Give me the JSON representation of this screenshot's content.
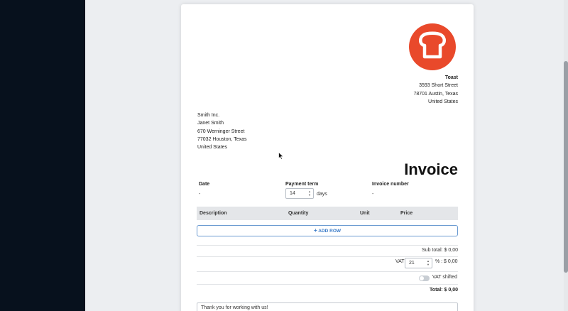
{
  "seller": {
    "name": "Toast",
    "street": "3593 Short Street",
    "city": "78701 Austin, Texas",
    "country": "United States"
  },
  "client": {
    "company": "Smith Inc.",
    "contact": "Janet Smith",
    "street": "670 Werninger Street",
    "city": "77032 Houston, Texas",
    "country": "United States"
  },
  "invoice": {
    "title": "Invoice",
    "date_label": "Date",
    "date_value": "-",
    "payment_term_label": "Payment term",
    "payment_term_value": "14",
    "payment_term_unit": "days",
    "number_label": "Invoice number",
    "number_value": "-"
  },
  "table": {
    "columns": [
      "Description",
      "Quantity",
      "Unit",
      "Price"
    ],
    "add_row_label": "ADD ROW"
  },
  "totals": {
    "subtotal_text": "Sub total: $ 0,00",
    "vat_label": "VAT",
    "vat_value": "21",
    "vat_suffix": "% : $ 0,00",
    "vat_shifted_label": "VAT shifted",
    "vat_shifted_on": false,
    "total_text": "Total: $ 0,00"
  },
  "note": {
    "value": "Thank you for working with us!"
  },
  "colors": {
    "brand": "#e9492b",
    "accent": "#3a7bc8",
    "sidebar": "#07111d"
  },
  "icons": {
    "logo": "toast-logo-icon",
    "add": "plus-icon",
    "cursor": "mouse-cursor-icon"
  }
}
